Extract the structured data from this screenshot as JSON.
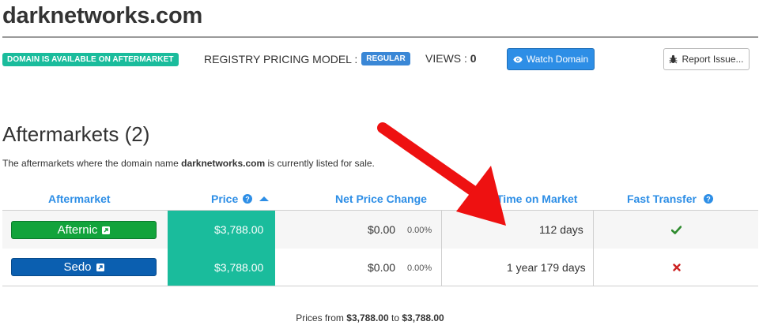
{
  "header": {
    "domain": "darknetworks.com",
    "availability_badge": "DOMAIN IS AVAILABLE ON AFTERMARKET",
    "pricing_label": "REGISTRY PRICING MODEL :",
    "pricing_value": "REGULAR",
    "views_label": "VIEWS :",
    "views_value": "0",
    "watch_button": "Watch Domain",
    "report_button": "Report Issue..."
  },
  "aftermarkets": {
    "title": "Aftermarkets (2)",
    "desc_prefix": "The aftermarkets where the domain name ",
    "desc_domain": "darknetworks.com",
    "desc_suffix": " is currently listed for sale.",
    "columns": {
      "market": "Aftermarket",
      "price": "Price",
      "change": "Net Price Change",
      "time": "Time on Market",
      "transfer": "Fast Transfer"
    },
    "rows": [
      {
        "market": "Afternic",
        "price": "$3,788.00",
        "change": "$0.00",
        "change_pct": "0.00%",
        "time": "112 days",
        "fast_transfer": "check-icon"
      },
      {
        "market": "Sedo",
        "price": "$3,788.00",
        "change": "$0.00",
        "change_pct": "0.00%",
        "time": "1 year 179 days",
        "fast_transfer": "x-icon"
      }
    ]
  },
  "footer": {
    "prefix": "Prices from ",
    "min": "$3,788.00",
    "middle": " to ",
    "max": "$3,788.00"
  },
  "colors": {
    "teal": "#1abc9c",
    "blue": "#2d8ee6",
    "afternic_green": "#12a33b",
    "sedo_blue": "#0b5fb0",
    "arrow_red": "#ee1111",
    "check_green": "#2e8b2e",
    "x_red": "#cc2222"
  }
}
